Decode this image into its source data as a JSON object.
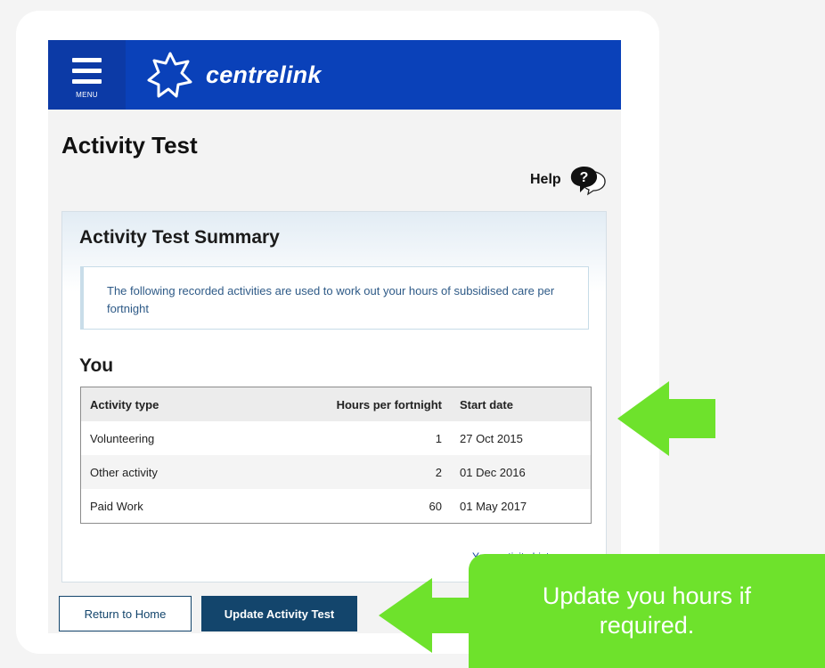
{
  "header": {
    "menu_label": "MENU",
    "brand": "centrelink",
    "brand_color": "#0a41b9",
    "logo_icon": "centrelink-star-logo"
  },
  "page": {
    "title": "Activity Test",
    "help_label": "Help"
  },
  "summary": {
    "title": "Activity Test Summary",
    "info_text": "The following recorded activities are used to work out your hours of subsidised care per fortnight",
    "section_heading": "You",
    "columns": [
      "Activity type",
      "Hours per fortnight",
      "Start date"
    ],
    "rows": [
      {
        "activity": "Volunteering",
        "hours": "1",
        "start": "27 Oct 2015"
      },
      {
        "activity": "Other activity",
        "hours": "2",
        "start": "01 Dec 2016"
      },
      {
        "activity": "Paid Work",
        "hours": "60",
        "start": "01 May 2017"
      }
    ],
    "history_link": "Your activity history"
  },
  "actions": {
    "home_label": "Return to Home",
    "update_label": "Update Activity Test",
    "primary_color": "#13456c"
  },
  "annotation": {
    "callout_text": "Update you hours if required.",
    "accent_color": "#6ee22c"
  }
}
